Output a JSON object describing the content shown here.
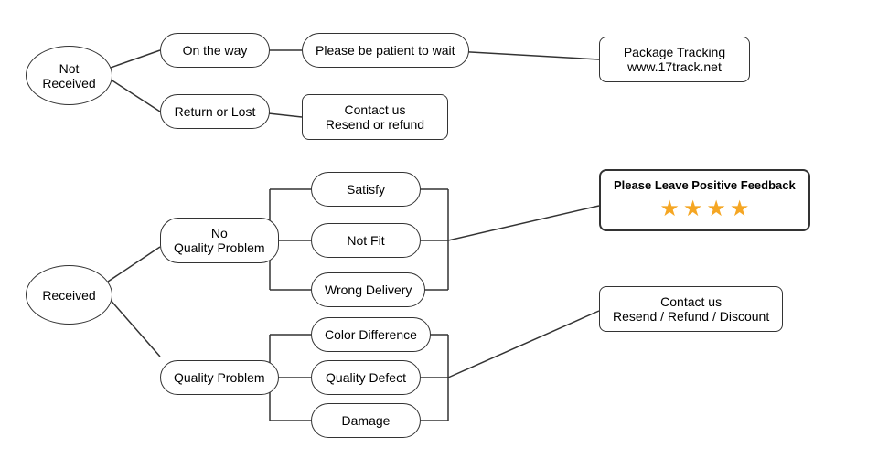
{
  "nodes": {
    "not_received": "Not\nReceived",
    "on_the_way": "On the way",
    "return_or_lost": "Return or Lost",
    "be_patient": "Please be patient to wait",
    "package_tracking": "Package Tracking\nwww.17track.net",
    "contact_resend_refund": "Contact us\nResend or refund",
    "received": "Received",
    "no_quality_problem": "No\nQuality Problem",
    "quality_problem": "Quality Problem",
    "satisfy": "Satisfy",
    "not_fit": "Not Fit",
    "wrong_delivery": "Wrong Delivery",
    "color_difference": "Color Difference",
    "quality_defect": "Quality Defect",
    "damage": "Damage",
    "please_leave_feedback": "Please Leave Positive Feedback",
    "contact_resend_refund_discount": "Contact us\nResend / Refund / Discount",
    "star": "★"
  }
}
